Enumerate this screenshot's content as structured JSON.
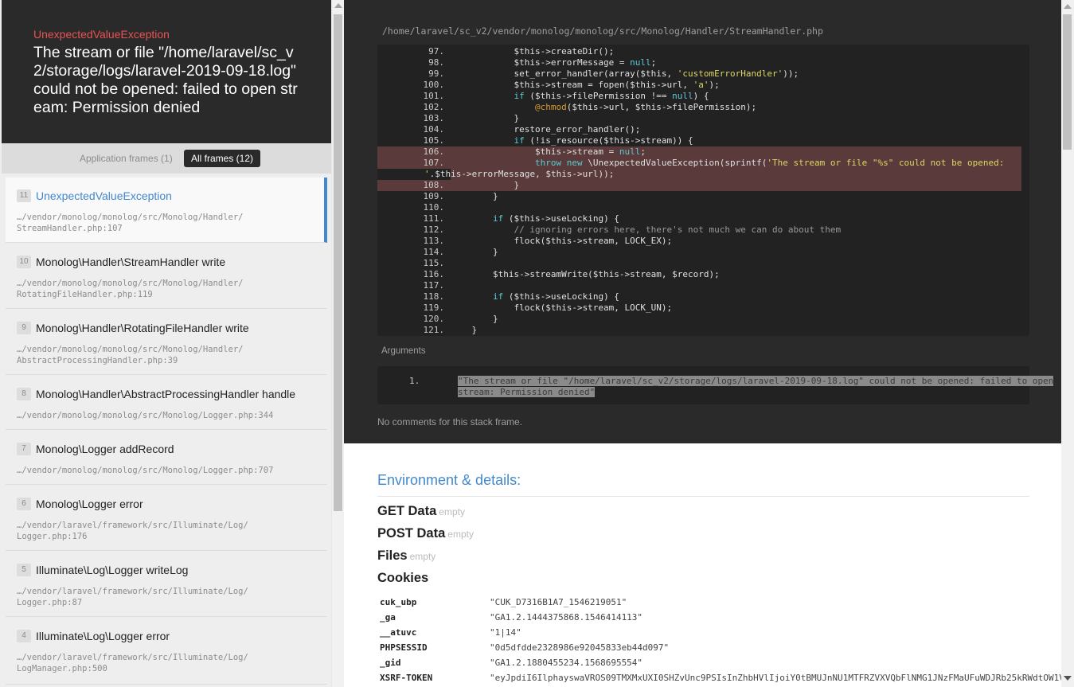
{
  "exception": {
    "class": "UnexpectedValueException",
    "message": "The stream or file \"/home/laravel/sc_v2/storage/logs/laravel-2019-09-18.log\" could not be opened: failed to open stream: Permission denied"
  },
  "tabs": {
    "application": "Application frames (1)",
    "all": "All frames (12)"
  },
  "frames": [
    {
      "num": "11",
      "cls": "UnexpectedValueException",
      "path1": "…/vendor/monolog/monolog/src/Monolog/Handler/",
      "path2": "StreamHandler.php:107"
    },
    {
      "num": "10",
      "cls": "Monolog\\Handler\\StreamHandler write",
      "path1": "…/vendor/monolog/monolog/src/Monolog/Handler/",
      "path2": "RotatingFileHandler.php:119"
    },
    {
      "num": "9",
      "cls": "Monolog\\Handler\\RotatingFileHandler write",
      "path1": "…/vendor/monolog/monolog/src/Monolog/Handler/",
      "path2": "AbstractProcessingHandler.php:39"
    },
    {
      "num": "8",
      "cls": "Monolog\\Handler\\AbstractProcessingHandler handle",
      "path1": "…/vendor/monolog/monolog/src/Monolog/Logger.php:344",
      "path2": ""
    },
    {
      "num": "7",
      "cls": "Monolog\\Logger addRecord",
      "path1": "…/vendor/monolog/monolog/src/Monolog/Logger.php:707",
      "path2": ""
    },
    {
      "num": "6",
      "cls": "Monolog\\Logger error",
      "path1": "…/vendor/laravel/framework/src/Illuminate/Log/",
      "path2": "Logger.php:176"
    },
    {
      "num": "5",
      "cls": "Illuminate\\Log\\Logger writeLog",
      "path1": "…/vendor/laravel/framework/src/Illuminate/Log/",
      "path2": "Logger.php:87"
    },
    {
      "num": "4",
      "cls": "Illuminate\\Log\\Logger error",
      "path1": "…/vendor/laravel/framework/src/Illuminate/Log/",
      "path2": "LogManager.php:500"
    }
  ],
  "file_path": "/home/laravel/sc_v2/vendor/monolog/monolog/src/Monolog/Handler/StreamHandler.php",
  "code": [
    {
      "n": "97.",
      "html": "            $this-&gt;createDir();"
    },
    {
      "n": "98.",
      "html": "            $this-&gt;errorMessage = <span class=\"kw\">null</span>;"
    },
    {
      "n": "99.",
      "html": "            set_error_handler(array($this, <span class=\"str\">'customErrorHandler'</span>));"
    },
    {
      "n": "100.",
      "html": "            $this-&gt;stream = fopen($this-&gt;url, <span class=\"str\">'a'</span>);"
    },
    {
      "n": "101.",
      "html": "            <span class=\"kw\">if</span> ($this-&gt;filePermission !== <span class=\"kw\">null</span>) {"
    },
    {
      "n": "102.",
      "html": "                <span class=\"at\">@chmod</span>($this-&gt;url, $this-&gt;filePermission);"
    },
    {
      "n": "103.",
      "html": "            }"
    },
    {
      "n": "104.",
      "html": "            restore_error_handler();"
    },
    {
      "n": "105.",
      "html": "            <span class=\"kw\">if</span> (!is_resource($this-&gt;stream)) {"
    },
    {
      "n": "106.",
      "html": "                $this-&gt;stream = <span class=\"kw\">null</span>;",
      "hl": true
    },
    {
      "n": "107.",
      "html": "                <span class=\"kw\">throw new</span> \\UnexpectedValueException(sprintf(<span class=\"str\">'The stream or file \"%s\" could not be opened: </span>",
      "hl": true
    },
    {
      "n": "",
      "html": "<span class=\"str\">'</span>.$this-&gt;errorMessage, $this-&gt;url));",
      "hl": true,
      "cont": true
    },
    {
      "n": "108.",
      "html": "            }",
      "hl": true
    },
    {
      "n": "109.",
      "html": "        }"
    },
    {
      "n": "110.",
      "html": ""
    },
    {
      "n": "111.",
      "html": "        <span class=\"kw\">if</span> ($this-&gt;useLocking) {"
    },
    {
      "n": "112.",
      "html": "            <span class=\"cmt\">// ignoring errors here, there's not much we can do about them</span>"
    },
    {
      "n": "113.",
      "html": "            flock($this-&gt;stream, LOCK_EX);"
    },
    {
      "n": "114.",
      "html": "        }"
    },
    {
      "n": "115.",
      "html": ""
    },
    {
      "n": "116.",
      "html": "        $this-&gt;streamWrite($this-&gt;stream, $record);"
    },
    {
      "n": "117.",
      "html": ""
    },
    {
      "n": "118.",
      "html": "        <span class=\"kw\">if</span> ($this-&gt;useLocking) {"
    },
    {
      "n": "119.",
      "html": "            flock($this-&gt;stream, LOCK_UN);"
    },
    {
      "n": "120.",
      "html": "        }"
    },
    {
      "n": "121.",
      "html": "    }"
    }
  ],
  "arguments": {
    "title": "Arguments",
    "num": "1.",
    "value": "\"The stream or file \"/home/laravel/sc_v2/storage/logs/laravel-2019-09-18.log\" could not be opened: failed to open stream: Permission denied\""
  },
  "no_comments": "No comments for this stack frame.",
  "env": {
    "title": "Environment & details:",
    "get": "GET Data",
    "post": "POST Data",
    "files": "Files",
    "empty": "empty",
    "cookies": "Cookies",
    "cookie_rows": [
      {
        "k": "cuk_ubp",
        "v": "\"CUK_D7316B1A7_1546219051\""
      },
      {
        "k": "_ga",
        "v": "\"GA1.2.1444375868.1546414113\""
      },
      {
        "k": "__atuvc",
        "v": "\"1|14\""
      },
      {
        "k": "PHPSESSID",
        "v": "\"0d5dfdde2328986e92045833eb44d097\""
      },
      {
        "k": "_gid",
        "v": "\"GA1.2.1880455234.1568695554\""
      },
      {
        "k": "XSRF-TOKEN",
        "v": "\"eyJpdiI6IlphayswaVROS09TMXMxUXI0SHZvUnc9PSIsInZhbHVlIjoiY0tBMUJnNU1MTFRZVXVQbFlNMG1JNzFMaUFuWDJRb25kRWdtOW1V"
      }
    ]
  }
}
